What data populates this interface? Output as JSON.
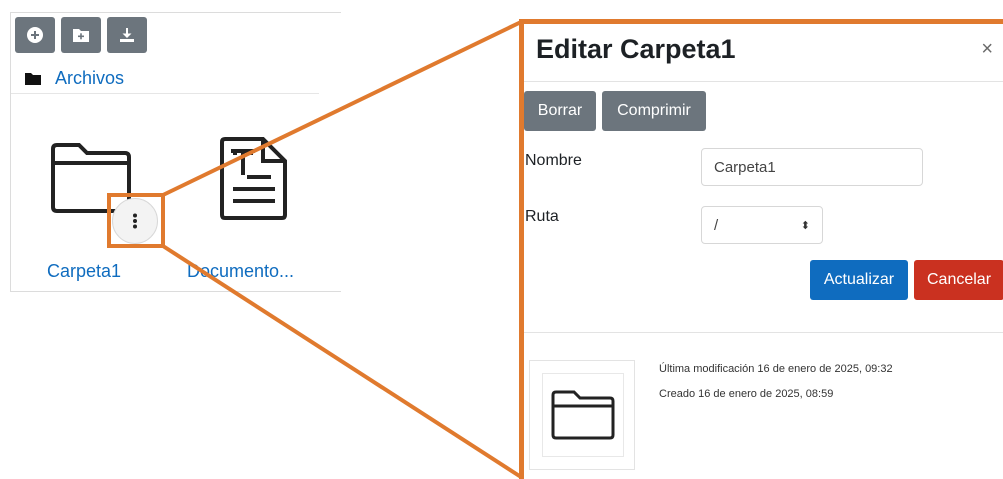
{
  "file_manager": {
    "toolbar": {
      "add_icon": "plus-circle-icon",
      "new_folder_icon": "folder-plus-icon",
      "download_icon": "download-icon"
    },
    "path": {
      "icon": "folder-icon",
      "label": "Archivos"
    },
    "items": [
      {
        "label": "Carpeta1",
        "icon": "folder-icon"
      },
      {
        "label": "Documento...",
        "icon": "text-document-icon"
      }
    ],
    "item_menu_icon": "kebab-menu-icon"
  },
  "dialog": {
    "title": "Editar Carpeta1",
    "close_label": "×",
    "buttons": {
      "delete": "Borrar",
      "compress": "Comprimir",
      "update": "Actualizar",
      "cancel": "Cancelar"
    },
    "fields": {
      "name_label": "Nombre",
      "name_value": "Carpeta1",
      "path_label": "Ruta",
      "path_value": "/",
      "path_arrow": "⬍"
    },
    "meta": {
      "modified": "Última modificación   16 de enero de 2025, 09:32",
      "created": "Creado   16 de enero de 2025, 08:59"
    }
  },
  "colors": {
    "callout": "#e07a2e",
    "link": "#0f6cbf",
    "secondary_button": "#6c757d",
    "primary_button": "#0f6cbf",
    "danger_button": "#ca3120"
  }
}
